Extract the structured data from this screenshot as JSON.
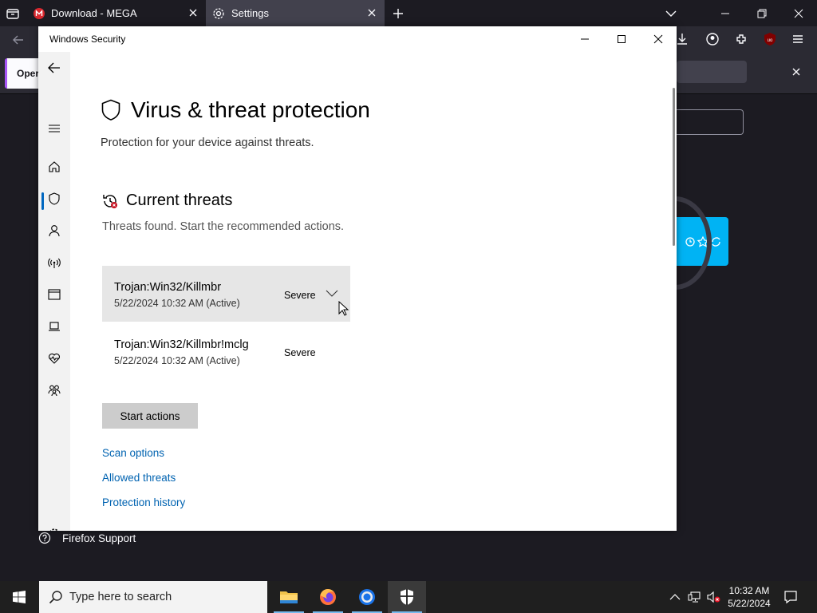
{
  "browser": {
    "tabs": [
      {
        "label": "Download - MEGA"
      },
      {
        "label": "Settings"
      }
    ],
    "extension_bar_label": "Oper",
    "firefox_support_label": "Firefox Support"
  },
  "window": {
    "title": "Windows Security",
    "page_title": "Virus & threat protection",
    "page_subtitle": "Protection for your device against threats.",
    "section_title": "Current threats",
    "section_description": "Threats found. Start the recommended actions.",
    "threats": [
      {
        "name": "Trojan:Win32/Killmbr",
        "date": "5/22/2024 10:32 AM (Active)",
        "severity": "Severe"
      },
      {
        "name": "Trojan:Win32/Killmbr!mclg",
        "date": "5/22/2024 10:32 AM (Active)",
        "severity": "Severe"
      }
    ],
    "start_actions_label": "Start actions",
    "links": {
      "scan_options": "Scan options",
      "allowed_threats": "Allowed threats",
      "protection_history": "Protection history"
    },
    "nav_icons": [
      "back-icon",
      "menu-icon",
      "home-icon",
      "shield-icon",
      "account-icon",
      "firewall-icon",
      "app-browser-icon",
      "device-security-icon",
      "health-icon",
      "family-icon",
      "settings-icon"
    ]
  },
  "taskbar": {
    "search_placeholder": "Type here to search",
    "time": "10:32 AM",
    "date": "5/22/2024"
  },
  "colors": {
    "accent": "#0067c0",
    "link": "#0063b1",
    "hover_card": "#e6e6e6",
    "taskbar": "#1f1f1f"
  }
}
